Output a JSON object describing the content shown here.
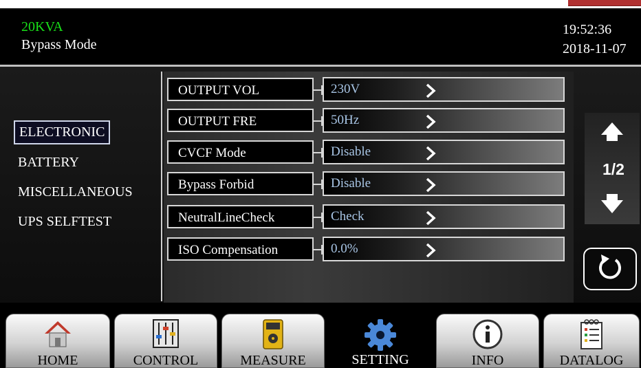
{
  "header": {
    "model": "20KVA",
    "mode": "Bypass Mode",
    "time": "19:52:36",
    "date": "2018-11-07"
  },
  "sidebar": {
    "items": [
      {
        "label": "ELECTRONIC",
        "active": true
      },
      {
        "label": "BATTERY",
        "active": false
      },
      {
        "label": "MISCELLANEOUS",
        "active": false
      },
      {
        "label": "UPS SELFTEST",
        "active": false
      }
    ]
  },
  "settings": [
    {
      "label": "OUTPUT VOL",
      "value": "230V"
    },
    {
      "label": "OUTPUT FRE",
      "value": "50Hz"
    },
    {
      "label": "CVCF Mode",
      "value": "Disable"
    },
    {
      "label": "Bypass Forbid",
      "value": "Disable"
    },
    {
      "label": "NeutralLineCheck",
      "value": "Check"
    },
    {
      "label": "ISO Compensation",
      "value": "0.0%"
    }
  ],
  "pager": {
    "indicator": "1/2",
    "up_icon": "arrow-up-icon",
    "down_icon": "arrow-down-icon",
    "back_icon": "refresh-icon"
  },
  "nav": {
    "tabs": [
      {
        "label": "HOME",
        "icon": "home-icon"
      },
      {
        "label": "CONTROL",
        "icon": "sliders-icon"
      },
      {
        "label": "MEASURE",
        "icon": "multimeter-icon"
      },
      {
        "label": "SETTING",
        "icon": "gear-icon",
        "active": true
      },
      {
        "label": "INFO",
        "icon": "info-icon"
      },
      {
        "label": "DATALOG",
        "icon": "log-icon"
      }
    ]
  },
  "colors": {
    "model_text": "#19e019",
    "value_text": "#a9c6e6",
    "background": "#000000"
  }
}
